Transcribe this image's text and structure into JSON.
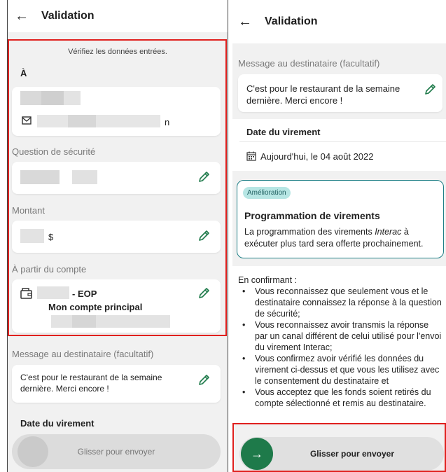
{
  "left": {
    "header": {
      "title": "Validation"
    },
    "verify_text": "Vérifiez les données entrées.",
    "to_label": "À",
    "security_label": "Question de sécurité",
    "amount_label": "Montant",
    "currency": "$",
    "from_label": "À partir du compte",
    "account_suffix": "- EOP",
    "account_name": "Mon compte principal",
    "message_label": "Message au destinataire (facultatif)",
    "message_text": "C'est pour le restaurant de la semaine dernière. Merci encore !",
    "date_label": "Date du virement",
    "slide_label": "Glisser pour envoyer",
    "email_tail": "n"
  },
  "right": {
    "header": {
      "title": "Validation"
    },
    "message_label": "Message au destinataire (facultatif)",
    "message_text": "C'est pour le restaurant de la semaine dernière. Merci encore !",
    "date_label": "Date du virement",
    "date_value": "Aujourd'hui, le 04 août 2022",
    "badge": "Amélioration",
    "promo_title": "Programmation de virements",
    "promo_body_pre": "La programmation des virements ",
    "promo_body_em": "Interac",
    "promo_body_post": " à exécuter plus tard sera offerte prochainement.",
    "confirm_intro": "En confirmant :",
    "bullets": [
      "Vous reconnaissez que seulement vous et le destinataire connaissez la réponse à la question de sécurité;",
      "Vous reconnaissez avoir transmis la réponse par un canal différent de celui utilisé pour l'envoi du virement Interac;",
      "Vous confirmez avoir vérifié les données du virement ci-dessus et que vous les utilisez avec le consentement du destinataire et",
      "Vous acceptez que les fonds soient retirés du compte sélectionné et remis au destinataire."
    ],
    "slide_label": "Glisser pour envoyer"
  },
  "colors": {
    "highlight_red": "#e0201e",
    "brand_green": "#1e7a4a",
    "teal": "#1f7f86"
  }
}
